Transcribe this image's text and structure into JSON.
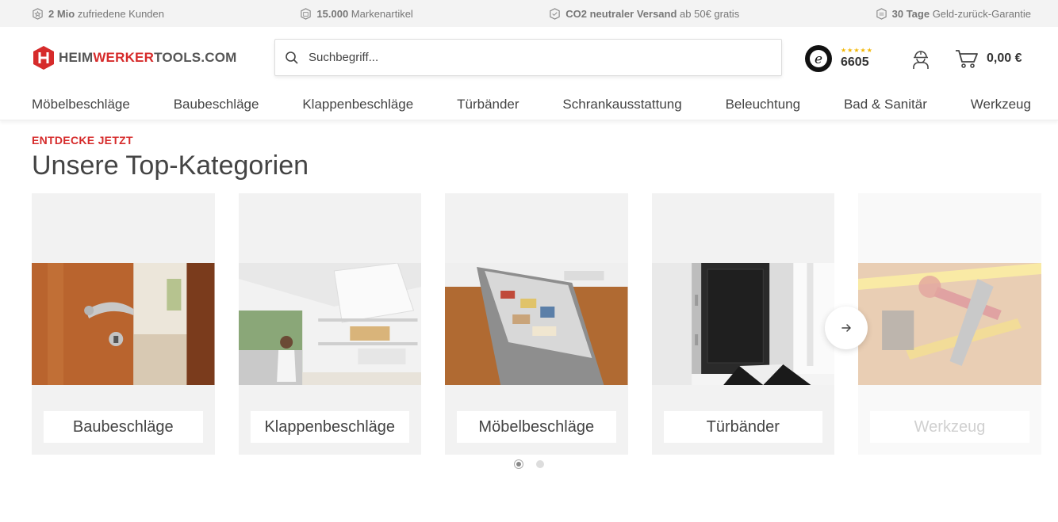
{
  "usp_bar": [
    {
      "bold": "2 Mio",
      "text": " zufriedene Kunden",
      "icon": "star-badge-icon"
    },
    {
      "bold": "15.000",
      "text": " Markenartikel",
      "icon": "box-badge-icon"
    },
    {
      "bold": "CO2 neutraler Versand",
      "text": " ab 50€ gratis",
      "icon": "shipping-badge-icon"
    },
    {
      "bold": "30 Tage",
      "text": " Geld-zurück-Garantie",
      "icon": "money-back-badge-icon"
    }
  ],
  "header": {
    "logo": {
      "part1": "HEIM",
      "part2": "WERKER",
      "part3": "TOOLS.COM"
    },
    "search": {
      "placeholder": "Suchbegriff..."
    },
    "trust": {
      "stars": "★★★★★",
      "count": "6605"
    },
    "cart": {
      "total": "0,00 €"
    }
  },
  "nav": {
    "items": [
      "Möbelbeschläge",
      "Baubeschläge",
      "Klappenbeschläge",
      "Türbänder",
      "Schrankausstattung",
      "Beleuchtung",
      "Bad & Sanitär",
      "Werkzeug"
    ]
  },
  "section": {
    "eyebrow": "ENTDECKE JETZT",
    "title": "Unsere Top-Kategorien",
    "cards": [
      {
        "label": "Baubeschläge"
      },
      {
        "label": "Klappenbeschläge"
      },
      {
        "label": "Möbelbeschläge"
      },
      {
        "label": "Türbänder"
      },
      {
        "label": "Werkzeug"
      }
    ]
  },
  "colors": {
    "accent": "#d62b2b",
    "card_bg": "#f2f2f2"
  }
}
